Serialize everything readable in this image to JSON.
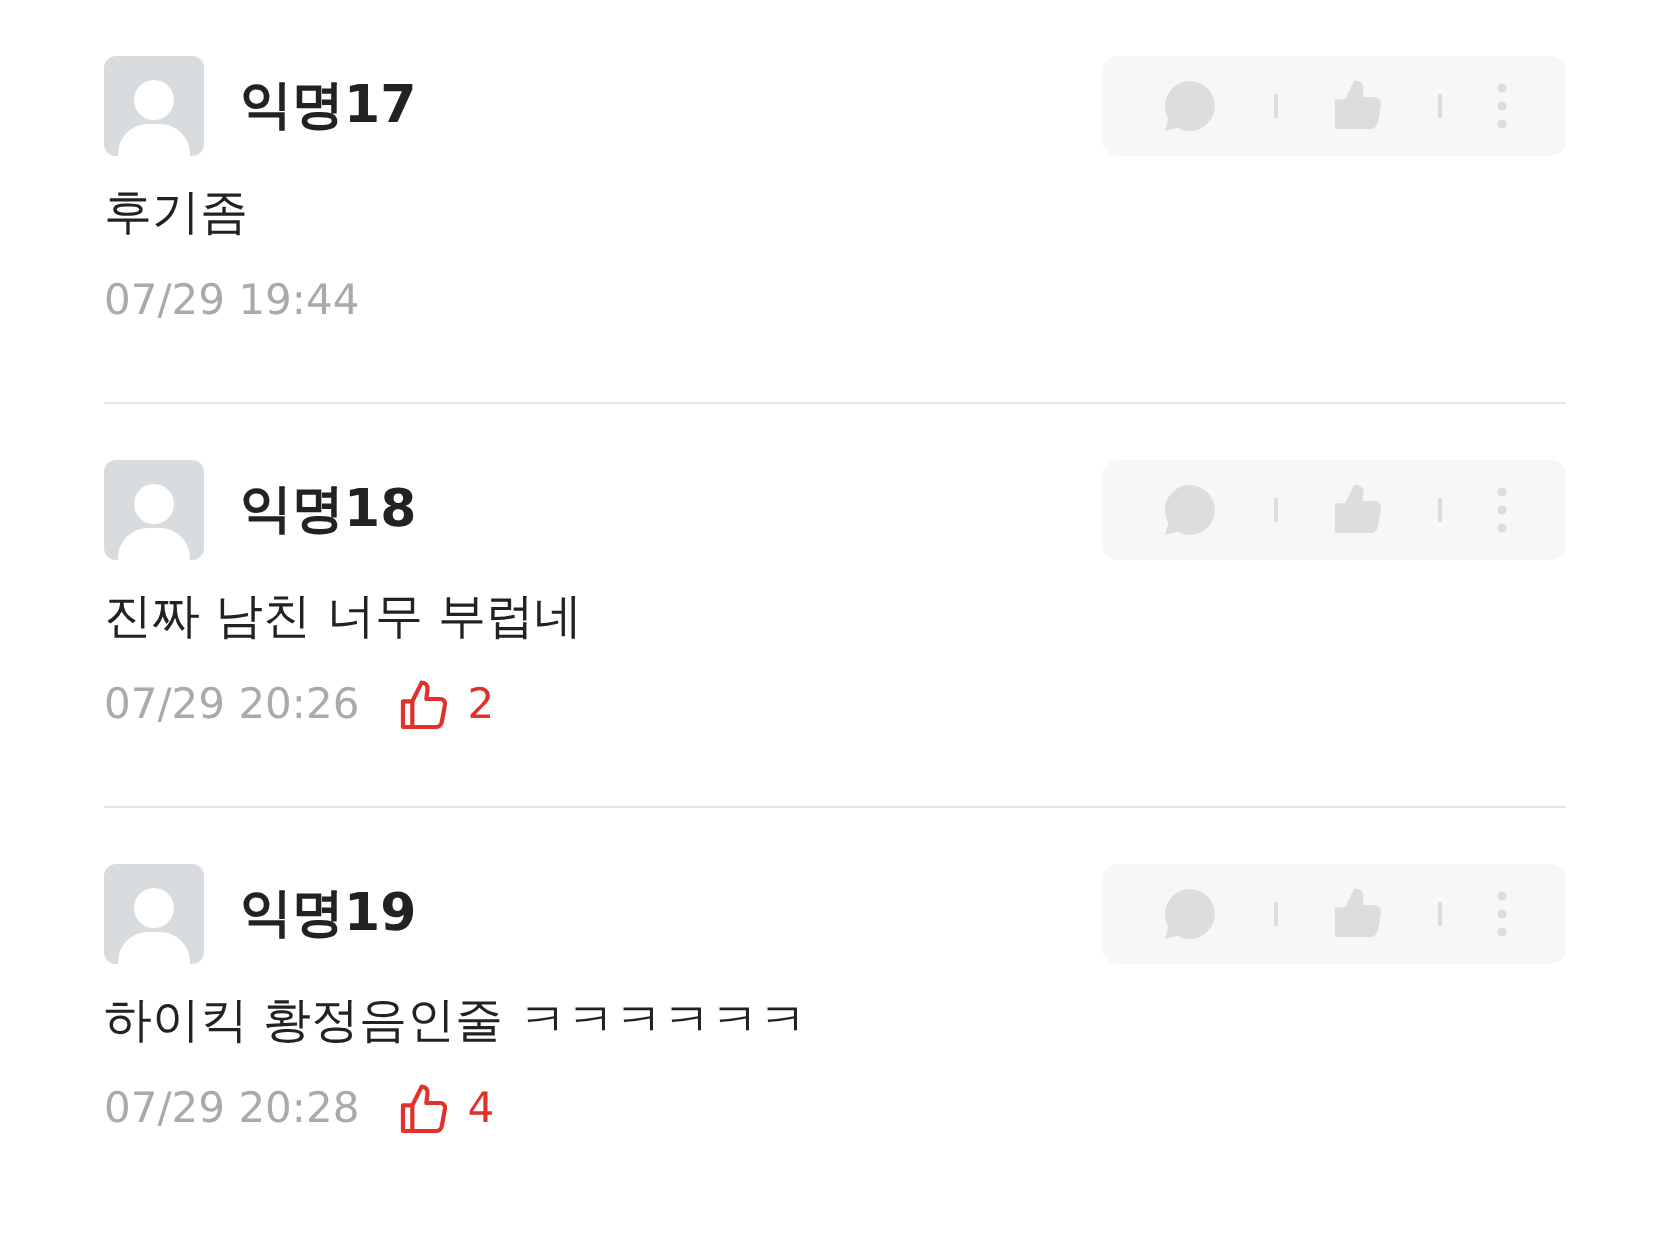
{
  "comments": [
    {
      "name": "익명17",
      "text": "후기좀",
      "time": "07/29 19:44"
    },
    {
      "name": "익명18",
      "text": "진짜 남친 너무 부럽네",
      "time": "07/29 20:26",
      "likes": "2"
    },
    {
      "name": "익명19",
      "text": "하이킥 황정음인줄 ㅋㅋㅋㅋㅋㅋ",
      "time": "07/29 20:28",
      "likes": "4"
    }
  ]
}
